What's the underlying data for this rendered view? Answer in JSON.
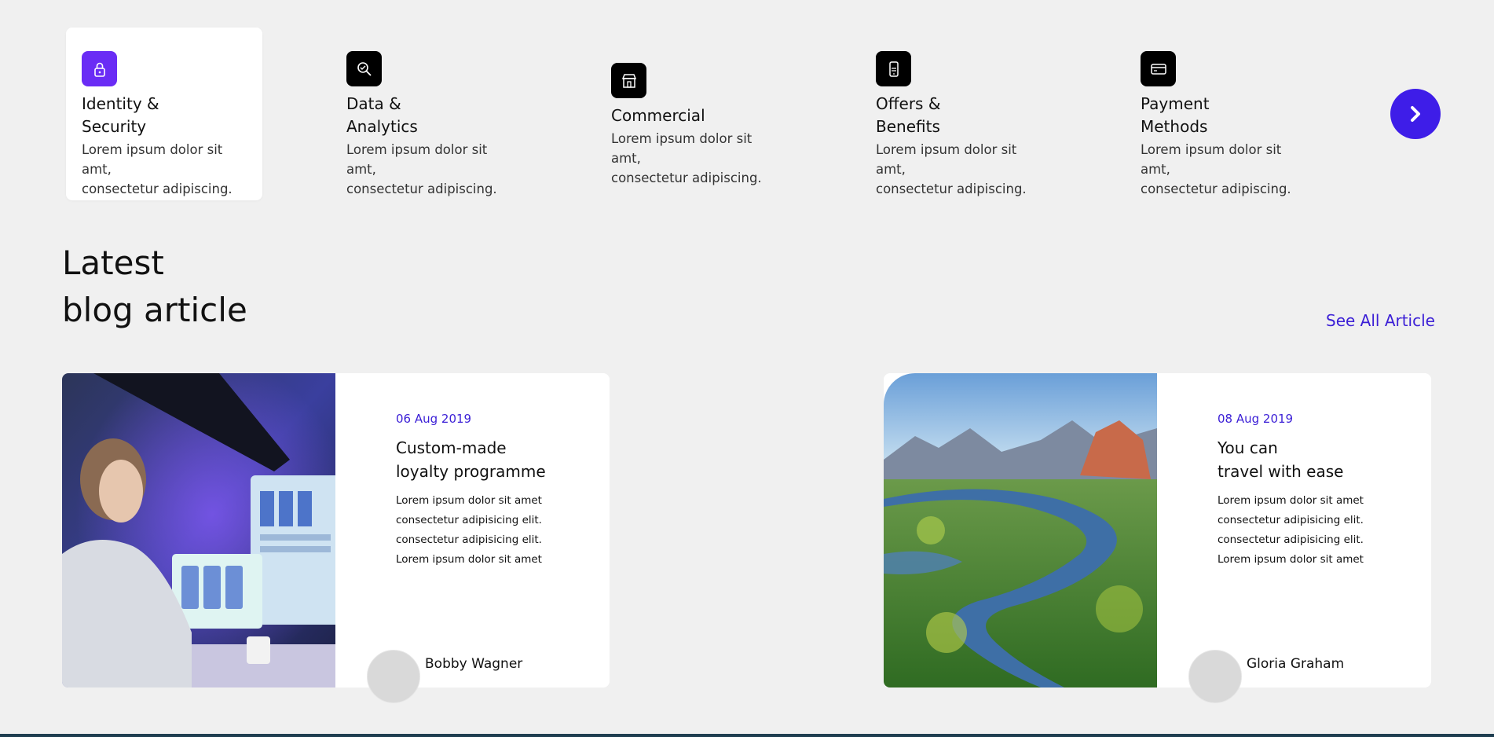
{
  "services": [
    {
      "title": "Identity &\nSecurity",
      "desc": "Lorem ipsum dolor sit amt,\nconsectetur adipiscing.",
      "icon": "lock-icon"
    },
    {
      "title": "Data &\nAnalytics",
      "desc": "Lorem ipsum dolor sit amt,\nconsectetur adipiscing.",
      "icon": "search-chart-icon"
    },
    {
      "title": "Commercial",
      "desc": "Lorem ipsum dolor sit amt,\nconsectetur adipiscing.",
      "icon": "store-icon"
    },
    {
      "title": "Offers &\nBenefits",
      "desc": "Lorem ipsum dolor sit amt,\nconsectetur adipiscing.",
      "icon": "phone-offer-icon"
    },
    {
      "title": "Payment\nMethods",
      "desc": "Lorem ipsum dolor sit amt,\nconsectetur adipiscing.",
      "icon": "credit-card-icon"
    }
  ],
  "blog": {
    "title": "Latest\nblog article",
    "see_all": "See All Article",
    "cards": [
      {
        "date": "06 Aug 2019",
        "title": "Custom-made\nloyalty programme",
        "excerpt": "Lorem ipsum dolor sit amet\nconsectetur adipisicing elit.\nconsectetur adipisicing elit.\nLorem ipsum dolor sit amet",
        "author": "Bobby Wagner"
      },
      {
        "date": "08 Aug 2019",
        "title": "You can\ntravel with ease",
        "excerpt": "Lorem ipsum dolor sit amet\nconsectetur adipisicing elit.\nconsectetur adipisicing elit.\nLorem ipsum dolor sit amet",
        "author": "Gloria Graham"
      }
    ]
  },
  "colors": {
    "accent": "#3b1fd6",
    "active_icon": "#6a2cf5",
    "background": "#f0f0f0"
  }
}
